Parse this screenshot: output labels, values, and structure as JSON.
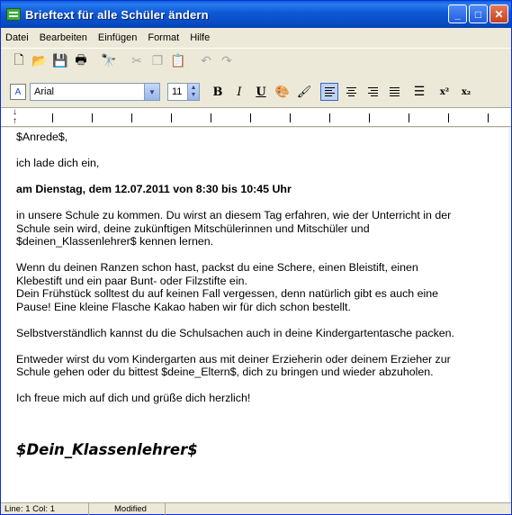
{
  "window": {
    "title": "Brieftext für alle Schüler ändern",
    "controls": {
      "minimize": "_",
      "maximize": "□",
      "close": "✕"
    }
  },
  "menu": [
    "Datei",
    "Bearbeiten",
    "Einfügen",
    "Format",
    "Hilfe"
  ],
  "toolbar": {
    "icons": [
      "new-document-icon",
      "open-folder-icon",
      "save-icon",
      "print-icon",
      "find-icon",
      "cut-icon",
      "copy-icon",
      "paste-icon",
      "undo-icon",
      "redo-icon"
    ]
  },
  "format_bar": {
    "font": "Arial",
    "size": "11",
    "bold": "B",
    "italic": "I",
    "underline": "U",
    "superscript": "x²",
    "subscript": "x₂"
  },
  "document": {
    "lines": [
      "$Anrede$,",
      "ich lade dich ein,",
      "am Dienstag, dem 12.07.2011 von 8:30 bis 10:45 Uhr",
      "in unsere Schule zu kommen. Du wirst an diesem Tag erfahren, wie der Unterricht in der\nSchule sein wird, deine zukünftigen Mitschülerinnen und Mitschüler und\n$deinen_Klassenlehrer$ kennen lernen.",
      "Wenn du deinen Ranzen schon hast, packst du eine Schere, einen Bleistift, einen\nKlebestift und ein paar Bunt- oder Filzstifte ein.\nDein Frühstück solltest du auf keinen Fall vergessen, denn natürlich gibt es auch eine\nPause! Eine kleine Flasche Kakao haben wir für dich schon bestellt.",
      "Selbstverständlich kannst du die Schulsachen auch in deine Kindergartentasche packen.",
      "Entweder wirst du vom Kindergarten aus mit deiner Erzieherin oder deinem Erzieher zur\nSchule gehen oder du bittest $deine_Eltern$, dich zu bringen und wieder abzuholen.",
      "Ich freue mich auf dich und grüße dich herzlich!"
    ],
    "signature": "$Dein_Klassenlehrer$"
  },
  "status": {
    "position": "Line:  1  Col:  1",
    "state": "Modified"
  },
  "colors": {
    "titlebar": "#0a4cc6",
    "chrome": "#ece9d8",
    "close_button": "#c8401c"
  }
}
